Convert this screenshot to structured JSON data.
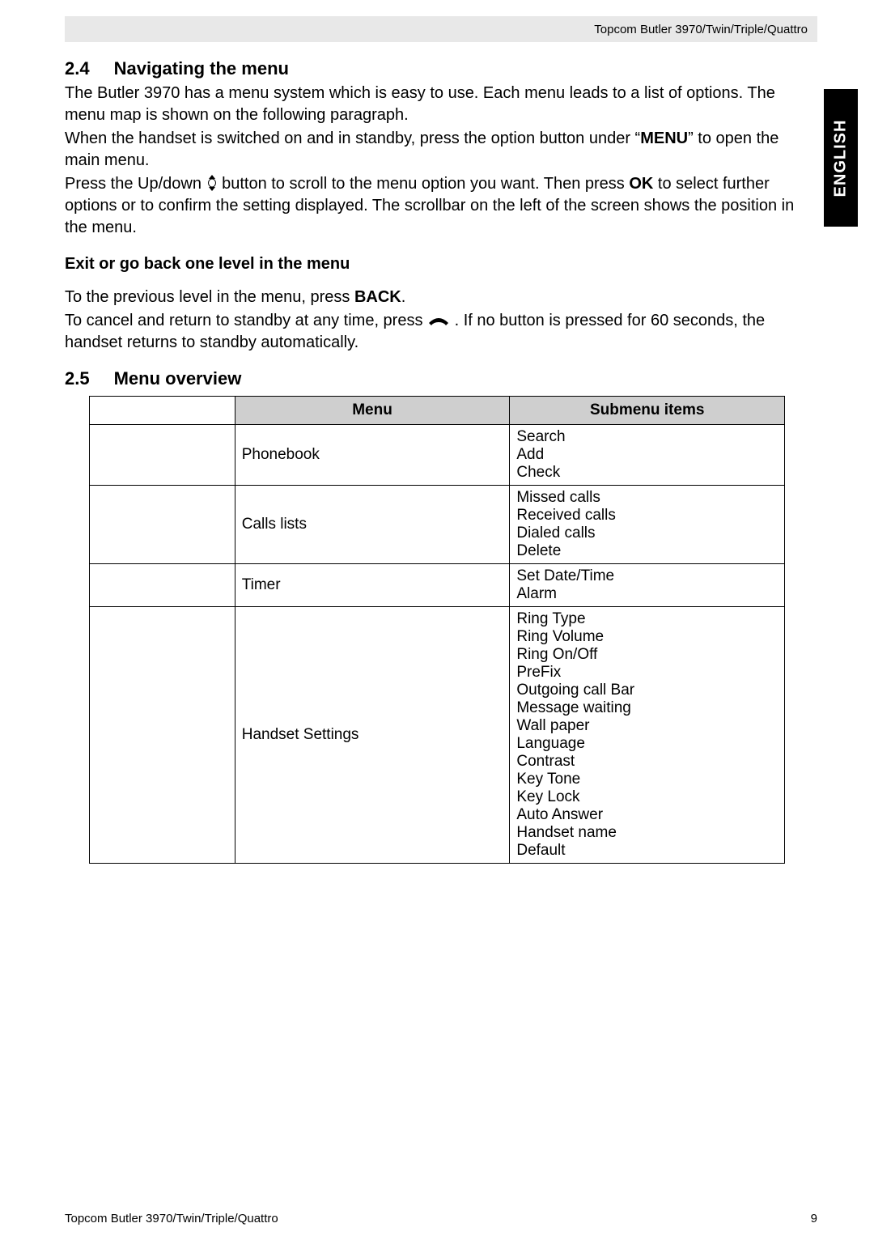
{
  "header": {
    "product": "Topcom Butler 3970/Twin/Triple/Quattro"
  },
  "side_tab": "ENGLISH",
  "section24": {
    "num": "2.4",
    "title": "Navigating the menu",
    "p1": "The Butler 3970 has a menu system which is easy to use. Each menu leads to a list of options. The menu map is shown on the following paragraph.",
    "p2a": "When the handset is switched on and in standby, press the option button under “",
    "p2_bold": "MENU",
    "p2b": "” to open the main menu.",
    "p3a": "Press the Up/down ",
    "p3b": " button to scroll to the menu option you want. Then press ",
    "p3_bold": "OK",
    "p3c": " to select further options or to confirm the setting displayed. The scrollbar on the left of the screen shows the position in the menu.",
    "sub_title": "Exit or go back one level in the menu",
    "p4a": "To the previous level in the menu, press ",
    "p4_bold": "BACK",
    "p4b": ".",
    "p5a": "To cancel and return to standby at any time, press ",
    "p5b": " . If no button is pressed for 60 seconds, the handset returns to standby automatically."
  },
  "section25": {
    "num": "2.5",
    "title": "Menu overview",
    "table": {
      "head_menu": "Menu",
      "head_sub": "Submenu items",
      "rows": [
        {
          "menu": "Phonebook",
          "sub": "Search\nAdd\nCheck"
        },
        {
          "menu": "Calls lists",
          "sub": "Missed calls\nReceived calls\nDialed calls\nDelete"
        },
        {
          "menu": "Timer",
          "sub": "Set Date/Time\nAlarm"
        },
        {
          "menu": "Handset Settings",
          "sub": "Ring Type\nRing Volume\nRing On/Off\nPreFix\nOutgoing call Bar\nMessage waiting\nWall paper\nLanguage\nContrast\nKey Tone\nKey Lock\nAuto Answer\nHandset name\nDefault"
        }
      ]
    }
  },
  "footer": {
    "left": "Topcom Butler 3970/Twin/Triple/Quattro",
    "right": "9"
  }
}
